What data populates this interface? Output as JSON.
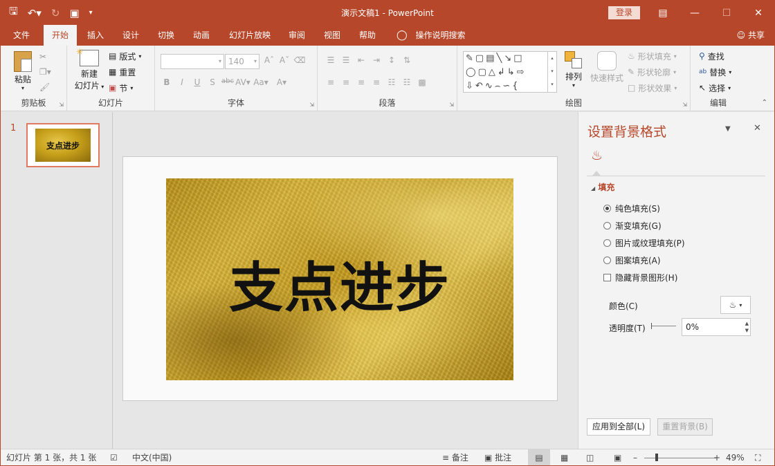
{
  "window": {
    "document_title": "演示文稿1",
    "separator": " - ",
    "app_name": "PowerPoint",
    "login_label": "登录"
  },
  "qat_icons": [
    "save-icon",
    "undo-icon",
    "redo-icon",
    "present-icon",
    "customize-icon"
  ],
  "menu": {
    "tabs": [
      "文件",
      "开始",
      "插入",
      "设计",
      "切换",
      "动画",
      "幻灯片放映",
      "审阅",
      "视图",
      "帮助"
    ],
    "active_tab": "开始",
    "tell_me": "操作说明搜索",
    "share": "共享"
  },
  "ribbon": {
    "clipboard": {
      "label": "剪贴板",
      "paste": "粘贴"
    },
    "slides": {
      "label": "幻灯片",
      "new_slide_line1": "新建",
      "new_slide_line2": "幻灯片",
      "layout": "版式",
      "reset": "重置",
      "section": "节"
    },
    "font": {
      "label": "字体",
      "font_name": "",
      "font_size": "140"
    },
    "paragraph": {
      "label": "段落"
    },
    "drawing": {
      "label": "绘图",
      "arrange": "排列",
      "quick_styles": "快速样式",
      "shape_fill": "形状填充",
      "shape_outline": "形状轮廓",
      "shape_effects": "形状效果"
    },
    "editing": {
      "label": "编辑",
      "find": "查找",
      "replace": "替换",
      "select": "选择"
    }
  },
  "thumbnails": [
    {
      "number": "1",
      "text": "支点进步"
    }
  ],
  "slide": {
    "text": "支点进步"
  },
  "format_pane": {
    "title": "设置背景格式",
    "section": "填充",
    "options": [
      {
        "label": "纯色填充(S)",
        "type": "radio",
        "checked": true
      },
      {
        "label": "渐变填充(G)",
        "type": "radio",
        "checked": false
      },
      {
        "label": "图片或纹理填充(P)",
        "type": "radio",
        "checked": false
      },
      {
        "label": "图案填充(A)",
        "type": "radio",
        "checked": false
      },
      {
        "label": "隐藏背景图形(H)",
        "type": "checkbox",
        "checked": false
      }
    ],
    "color_label": "颜色(C)",
    "transparency_label": "透明度(T)",
    "transparency_value": "0%",
    "apply_all": "应用到全部(L)",
    "reset_bg": "重置背景(B)"
  },
  "statusbar": {
    "slide_info": "幻灯片 第 1 张，共 1 张",
    "language": "中文(中国)",
    "notes": "备注",
    "comments": "批注",
    "zoom": "49%"
  },
  "colors": {
    "accent": "#b7472a",
    "pane_bg": "#f3f3f3",
    "canvas_bg": "#e6e6e6"
  }
}
